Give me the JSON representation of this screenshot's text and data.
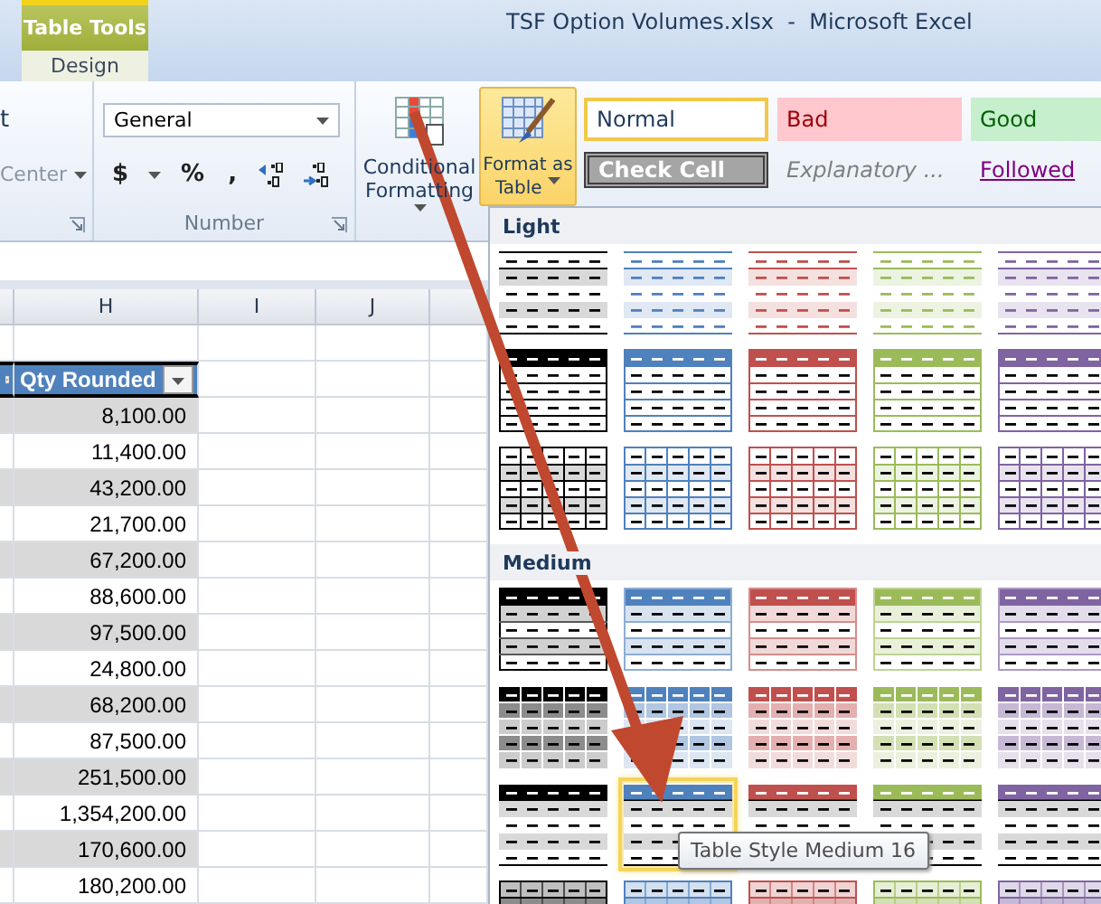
{
  "title_bar": {
    "contextual_group": "Table Tools",
    "title": "TSF Option Volumes.xlsx  -  Microsoft Excel"
  },
  "ribbon_tabs": [
    {
      "label": "Design",
      "selected": true
    }
  ],
  "ribbon": {
    "alignment": {
      "wrap_text": "t",
      "merge": "Center"
    },
    "number": {
      "format": "General",
      "buttons": [
        "$",
        "%",
        ","
      ],
      "label": "Number"
    },
    "styles": {
      "conditional_formatting": "Conditional Formatting",
      "format_as_table": {
        "label": "Format as Table",
        "pressed": true
      },
      "cell_styles": [
        {
          "label": "Normal",
          "kind": "normal",
          "selected": true
        },
        {
          "label": "Bad",
          "kind": "bad",
          "selected": false
        },
        {
          "label": "Good",
          "kind": "good",
          "selected": false
        },
        {
          "label": "Check Cell",
          "kind": "check",
          "selected": false
        },
        {
          "label": "Explanatory ...",
          "kind": "explanatory",
          "selected": false
        },
        {
          "label": "Followed",
          "kind": "followed",
          "selected": false
        }
      ]
    }
  },
  "sheet": {
    "columns": [
      "H",
      "I",
      "J"
    ],
    "table_header": "Qty Rounded",
    "rows": [
      "8,100.00",
      "11,400.00",
      "43,200.00",
      "21,700.00",
      "67,200.00",
      "88,600.00",
      "97,500.00",
      "24,800.00",
      "68,200.00",
      "87,500.00",
      "251,500.00",
      "1,354,200.00",
      "170,600.00",
      "180,200.00"
    ]
  },
  "gallery": {
    "sections": [
      {
        "title": "Light",
        "rows": [
          {
            "kind": "light-lines",
            "swatches": [
              {
                "color": "#000000",
                "selected": false
              },
              {
                "color": "#4f81bd",
                "selected": false
              },
              {
                "color": "#c0504d",
                "selected": false
              },
              {
                "color": "#9bbb59",
                "selected": false
              },
              {
                "color": "#8064a2",
                "selected": false
              }
            ]
          },
          {
            "kind": "light-header",
            "swatches": [
              {
                "color": "#000000",
                "selected": false
              },
              {
                "color": "#4f81bd",
                "selected": false
              },
              {
                "color": "#c0504d",
                "selected": false
              },
              {
                "color": "#9bbb59",
                "selected": false
              },
              {
                "color": "#8064a2",
                "selected": false
              }
            ]
          },
          {
            "kind": "light-grid",
            "swatches": [
              {
                "color": "#000000",
                "selected": false
              },
              {
                "color": "#4f81bd",
                "selected": false
              },
              {
                "color": "#c0504d",
                "selected": false
              },
              {
                "color": "#9bbb59",
                "selected": false
              },
              {
                "color": "#8064a2",
                "selected": false
              }
            ]
          }
        ]
      },
      {
        "title": "Medium",
        "rows": [
          {
            "kind": "medium-banded",
            "swatches": [
              {
                "color": "#000000",
                "selected": false
              },
              {
                "color": "#4f81bd",
                "selected": false
              },
              {
                "color": "#c0504d",
                "selected": false
              },
              {
                "color": "#9bbb59",
                "selected": false
              },
              {
                "color": "#8064a2",
                "selected": false
              }
            ]
          },
          {
            "kind": "medium-grid",
            "swatches": [
              {
                "color": "#000000",
                "selected": false
              },
              {
                "color": "#4f81bd",
                "selected": false
              },
              {
                "color": "#c0504d",
                "selected": false
              },
              {
                "color": "#9bbb59",
                "selected": false
              },
              {
                "color": "#8064a2",
                "selected": false
              }
            ]
          },
          {
            "kind": "medium-gray-bands",
            "swatches": [
              {
                "color": "#000000",
                "selected": false
              },
              {
                "color": "#4f81bd",
                "selected": true
              },
              {
                "color": "#c0504d",
                "selected": false
              },
              {
                "color": "#9bbb59",
                "selected": false
              },
              {
                "color": "#8064a2",
                "selected": false
              }
            ]
          },
          {
            "kind": "medium-grid-light",
            "swatches": [
              {
                "color": "#000000",
                "selected": false
              },
              {
                "color": "#4f81bd",
                "selected": false
              },
              {
                "color": "#c0504d",
                "selected": false
              },
              {
                "color": "#9bbb59",
                "selected": false
              },
              {
                "color": "#8064a2",
                "selected": false
              }
            ]
          }
        ]
      }
    ],
    "tooltip": "Table Style Medium 16"
  }
}
